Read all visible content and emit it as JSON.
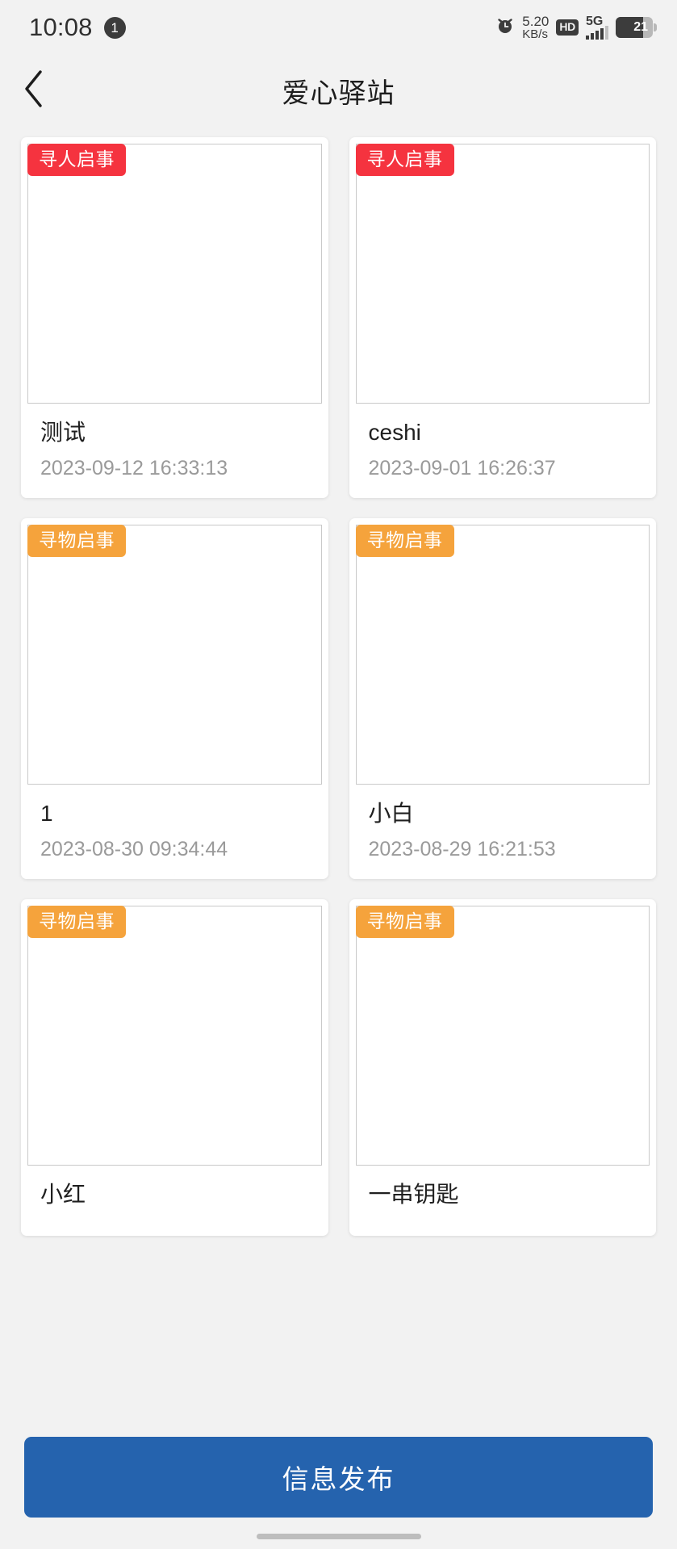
{
  "status_bar": {
    "time": "10:08",
    "notification_count": "1",
    "alarm_icon": "alarm-clock-icon",
    "network_speed_value": "5.20",
    "network_speed_unit": "KB/s",
    "hd_label": "HD",
    "network_type": "5G",
    "battery_level": "21"
  },
  "header": {
    "back_icon": "chevron-left-icon",
    "title": "爱心驿站"
  },
  "colors": {
    "badge_red": "#f5333f",
    "badge_orange": "#f5a33c",
    "primary_button": "#2563ae",
    "page_background": "#f2f2f2",
    "card_background": "#ffffff",
    "time_text": "#9a9a9a"
  },
  "list": {
    "cards": [
      {
        "badge": "寻人启事",
        "badge_type": "red",
        "title": "测试",
        "time": "2023-09-12 16:33:13"
      },
      {
        "badge": "寻人启事",
        "badge_type": "red",
        "title": "ceshi",
        "time": "2023-09-01 16:26:37"
      },
      {
        "badge": "寻物启事",
        "badge_type": "orange",
        "title": "1",
        "time": "2023-08-30 09:34:44"
      },
      {
        "badge": "寻物启事",
        "badge_type": "orange",
        "title": "小白",
        "time": "2023-08-29 16:21:53"
      },
      {
        "badge": "寻物启事",
        "badge_type": "orange",
        "title": "小红",
        "time": ""
      },
      {
        "badge": "寻物启事",
        "badge_type": "orange",
        "title": "一串钥匙",
        "time": ""
      }
    ]
  },
  "footer": {
    "publish_label": "信息发布"
  }
}
